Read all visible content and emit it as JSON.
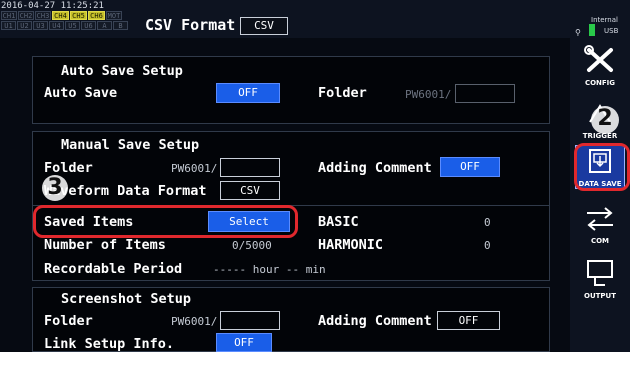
{
  "header": {
    "timestamp": "2016-04-27 11:25:21",
    "channels_top": [
      "CH1",
      "CH2",
      "CH3",
      "CH4",
      "CH5",
      "CH6",
      "MOT"
    ],
    "channels_top_active": [
      false,
      false,
      false,
      true,
      true,
      true,
      false
    ],
    "channels_bottom": [
      "U1",
      "U2",
      "U3",
      "U4",
      "U5",
      "U6",
      "A",
      "B"
    ],
    "title": "CSV Format",
    "format_value": "CSV",
    "storage_label": "Internal",
    "storage_usb": "USB"
  },
  "auto_save": {
    "heading": "Auto Save Setup",
    "auto_save_label": "Auto Save",
    "auto_save_value": "OFF",
    "folder_label": "Folder",
    "folder_value": "PW6001/",
    "folder_field": ""
  },
  "manual_save": {
    "heading": "Manual Save Setup",
    "folder_label": "Folder",
    "folder_value": "PW6001/",
    "folder_field": "",
    "adding_comment_label": "Adding Comment",
    "adding_comment_value": "OFF",
    "waveform_label": "Waveform Data Format",
    "waveform_value": "CSV",
    "saved_items_label": "Saved Items",
    "saved_items_button": "Select",
    "basic_label": "BASIC",
    "basic_value": "0",
    "number_items_label": "Number of Items",
    "number_items_value": "0/5000",
    "harmonic_label": "HARMONIC",
    "harmonic_value": "0",
    "recordable_label": "Recordable Period",
    "recordable_value": "----- hour -- min"
  },
  "screenshot": {
    "heading": "Screenshot Setup",
    "folder_label": "Folder",
    "folder_value": "PW6001/",
    "folder_field": "",
    "adding_comment_label": "Adding Comment",
    "adding_comment_value": "OFF",
    "link_label": "Link Setup Info.",
    "link_value": "OFF"
  },
  "sidebar": {
    "config": "CONFIG",
    "trigger": "TRIGGER",
    "data_save": "DATA SAVE",
    "com": "COM",
    "output": "OUTPUT"
  },
  "callouts": {
    "one": "2",
    "two": "3"
  },
  "colors": {
    "accent_blue": "#1a5ee8",
    "highlight_red": "#e0282d",
    "channel_active": "#c6c02a"
  }
}
